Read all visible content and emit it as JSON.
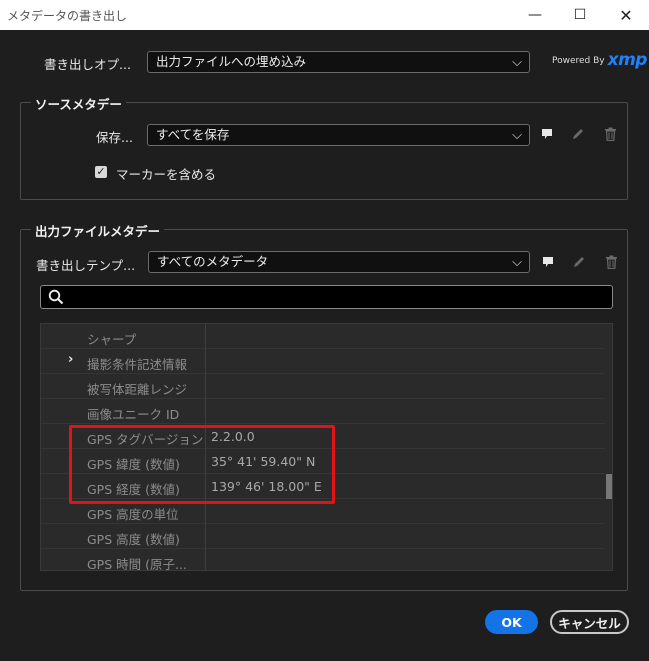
{
  "window": {
    "title": "メタデータの書き出し",
    "minimize": "—",
    "maximize": "☐",
    "close": "✕"
  },
  "export_options": {
    "label": "書き出しオプ...",
    "value": "出力ファイルへの埋め込み",
    "brand_prefix": "Powered By",
    "brand": "xmp"
  },
  "source_metadata": {
    "group_title": "ソースメタデー",
    "save_label": "保存...",
    "save_value": "すべてを保存",
    "include_markers_label": "マーカーを含める",
    "include_markers_checked": true
  },
  "output_metadata": {
    "group_title": "出力ファイルメタデー",
    "template_label": "書き出しテンプ...",
    "template_value": "すべてのメタデータ",
    "search_placeholder": ""
  },
  "table": {
    "rows": [
      {
        "name": "シャープ",
        "value": "",
        "expandable": false
      },
      {
        "name": "撮影条件記述情報",
        "value": "",
        "expandable": true
      },
      {
        "name": "被写体距離レンジ",
        "value": "",
        "expandable": false
      },
      {
        "name": "画像ユニーク ID",
        "value": "",
        "expandable": false
      },
      {
        "name": "GPS タグバージョン",
        "value": "2.2.0.0",
        "expandable": false
      },
      {
        "name": "GPS 緯度 (数値)",
        "value": "35° 41' 59.40\" N",
        "expandable": false
      },
      {
        "name": "GPS 経度 (数値)",
        "value": "139° 46' 18.00\" E",
        "expandable": false
      },
      {
        "name": "GPS 高度の単位",
        "value": "",
        "expandable": false
      },
      {
        "name": "GPS 高度 (数値)",
        "value": "",
        "expandable": false
      },
      {
        "name": "GPS 時間 (原子...",
        "value": "",
        "expandable": false
      }
    ]
  },
  "buttons": {
    "ok": "OK",
    "cancel": "キャンセル"
  },
  "colors": {
    "accent": "#1473e6",
    "highlight": "#e01414",
    "background": "#1e1e1e"
  }
}
